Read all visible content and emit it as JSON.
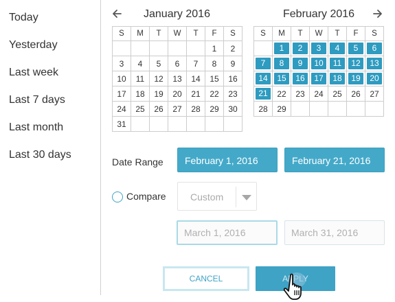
{
  "presets": [
    "Today",
    "Yesterday",
    "Last week",
    "Last 7 days",
    "Last month",
    "Last 30 days"
  ],
  "calendar": {
    "prev_icon": "arrow-left-icon",
    "next_icon": "arrow-right-icon",
    "weekdays": [
      "S",
      "M",
      "T",
      "W",
      "T",
      "F",
      "S"
    ],
    "left": {
      "title": "January 2016",
      "weeks": [
        [
          "",
          "",
          "",
          "",
          "",
          "1",
          "2"
        ],
        [
          "3",
          "4",
          "5",
          "6",
          "7",
          "8",
          "9"
        ],
        [
          "10",
          "11",
          "12",
          "13",
          "14",
          "15",
          "16"
        ],
        [
          "17",
          "18",
          "19",
          "20",
          "21",
          "22",
          "23"
        ],
        [
          "24",
          "25",
          "26",
          "27",
          "28",
          "29",
          "30"
        ],
        [
          "31",
          "",
          "",
          "",
          "",
          "",
          ""
        ]
      ]
    },
    "right": {
      "title": "February 2016",
      "weeks": [
        [
          "",
          "1",
          "2",
          "3",
          "4",
          "5",
          "6"
        ],
        [
          "7",
          "8",
          "9",
          "10",
          "11",
          "12",
          "13"
        ],
        [
          "14",
          "15",
          "16",
          "17",
          "18",
          "19",
          "20"
        ],
        [
          "21",
          "22",
          "23",
          "24",
          "25",
          "26",
          "27"
        ],
        [
          "28",
          "29",
          "",
          "",
          "",
          "",
          ""
        ]
      ],
      "selected": [
        "1",
        "2",
        "3",
        "4",
        "5",
        "6",
        "7",
        "8",
        "9",
        "10",
        "11",
        "12",
        "13",
        "14",
        "15",
        "16",
        "17",
        "18",
        "19",
        "20",
        "21"
      ]
    }
  },
  "date_range": {
    "label": "Date Range",
    "start": "February 1, 2016",
    "end": "February 21, 2016"
  },
  "compare": {
    "label": "Compare",
    "select_value": "Custom",
    "start": "March 1, 2016",
    "end": "March 31, 2016"
  },
  "actions": {
    "cancel": "CANCEL",
    "apply": "APPLY"
  },
  "colors": {
    "accent": "#3ea3c5",
    "selected_day": "#2e9bc0"
  }
}
